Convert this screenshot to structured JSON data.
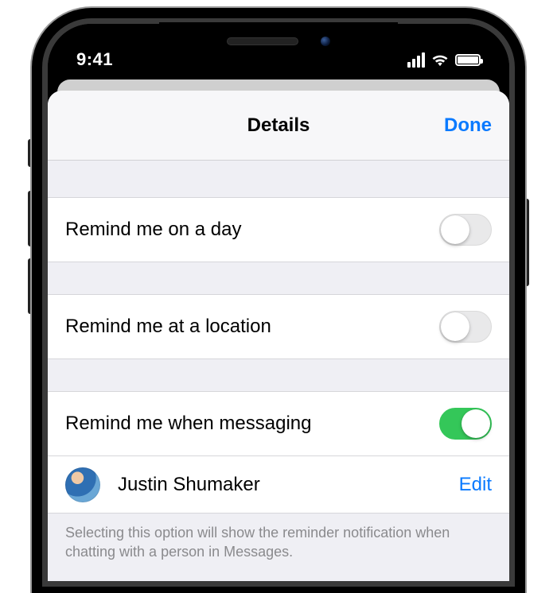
{
  "status": {
    "time": "9:41"
  },
  "modal": {
    "title": "Details",
    "done": "Done"
  },
  "rows": {
    "day": {
      "label": "Remind me on a day",
      "on": false
    },
    "location": {
      "label": "Remind me at a location",
      "on": false
    },
    "messaging": {
      "label": "Remind me when messaging",
      "on": true
    }
  },
  "contact": {
    "name": "Justin Shumaker",
    "edit": "Edit"
  },
  "footer": "Selecting this option will show the reminder notification when chatting with a person in Messages."
}
